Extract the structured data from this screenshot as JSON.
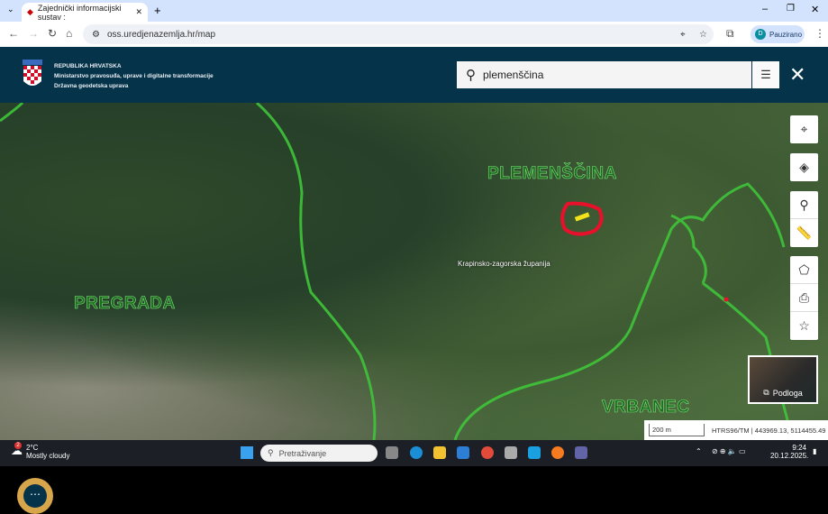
{
  "browser": {
    "tab_title": "Zajednički informacijski sustav :",
    "url": "oss.uredjenazemlja.hr/map",
    "profile_initial": "D",
    "profile_label": "Pauzirano"
  },
  "header": {
    "line1": "REPUBLIKA HRVATSKA",
    "line2": "Ministarstvo pravosuđa, uprave i digitalne transformacije",
    "line3": "Državna geodetska uprava"
  },
  "search": {
    "value": "plemenščina"
  },
  "map": {
    "labels": {
      "plemenscina": "PLEMENŠČINA",
      "pregrada": "PREGRADA",
      "vrbanec": "VRBANEC",
      "county": "Krapinsko-zagorska županija"
    },
    "basemap_label": "Podloga",
    "scale": "200 m",
    "coords": "HTRS96/TM | 443969.13, 5114455.49"
  },
  "taskbar": {
    "temp": "2°C",
    "weather": "Mostly cloudy",
    "weather_badge": "2",
    "search_placeholder": "Pretraživanje",
    "time": "9:24",
    "date": "20.12.2025."
  }
}
